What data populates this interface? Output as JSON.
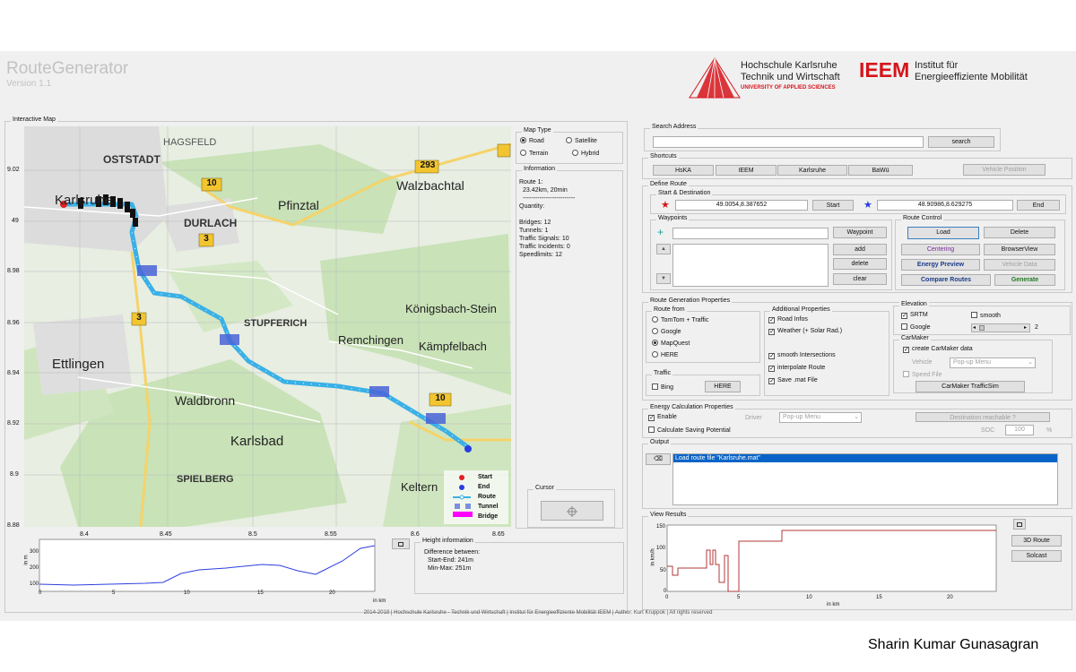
{
  "app": {
    "title": "RouteGenerator",
    "version": "Version 1.1"
  },
  "logos": {
    "hs_line1": "Hochschule Karlsruhe",
    "hs_line2": "Technik und Wirtschaft",
    "hs_line3": "UNIVERSITY OF APPLIED SCIENCES",
    "ieem": "IEEM",
    "ieem_line1": "Institut  für",
    "ieem_line2": "Energieeffiziente Mobilität"
  },
  "map": {
    "panel_title": "Interactive Map",
    "y_ticks": [
      "9.02",
      "49",
      "8.98",
      "8.96",
      "8.94",
      "8.92",
      "8.9",
      "8.88"
    ],
    "x_ticks": [
      "8.4",
      "8.45",
      "8.5",
      "8.55",
      "8.6",
      "8.65"
    ],
    "places": [
      "HAGSFELD",
      "OSTSTADT",
      "Karlsruhe",
      "DURLACH",
      "Pfinztal",
      "Walzbachtal",
      "STUPFERICH",
      "Königsbach-Stein",
      "Remchingen",
      "Kämpfelbach",
      "Ettlingen",
      "Waldbronn",
      "Karlsbad",
      "SPIELBERG",
      "Keltern"
    ],
    "road_signs": [
      "293",
      "10",
      "3",
      "3",
      "10"
    ],
    "legend": [
      "Start",
      "End",
      "Route",
      "Tunnel",
      "Bridge"
    ]
  },
  "map_type": {
    "title": "Map Type",
    "options": [
      "Road",
      "Satellite",
      "Terrain",
      "Hybrid"
    ],
    "selected": "Road"
  },
  "information": {
    "title": "Information",
    "lines": [
      "Route 1:",
      "23.42km, 20min",
      "-------------------------",
      "Quantity:",
      "",
      "Bridges: 12",
      "Tunnels: 1",
      "Traffic Signals: 10",
      "Traffic Incidents: 0",
      "Speedlimits: 12"
    ]
  },
  "cursor": {
    "title": "Cursor"
  },
  "height_info": {
    "title": "Height information",
    "lines": [
      "Difference between:",
      "Start-End: 241m",
      "Min-Max: 251m"
    ]
  },
  "height_chart": {
    "y_ticks": [
      "300",
      "200",
      "100"
    ],
    "x_ticks": [
      "0",
      "5",
      "10",
      "15",
      "20"
    ],
    "ylabel": "in m",
    "xlabel": "in km"
  },
  "search": {
    "title": "Search Address",
    "button": "search"
  },
  "shortcuts": {
    "title": "Shortcuts",
    "buttons": [
      "HsKA",
      "IEEM",
      "Karlsruhe",
      "BaWü"
    ],
    "disabled_button": "Vehicle Position"
  },
  "define_route": {
    "title": "Define Route",
    "start_dest_title": "Start & Destination",
    "start_value": "49.0054,8.387652",
    "start_button": "Start",
    "end_value": "48.90986,8.629275",
    "end_button": "End",
    "waypoints_title": "Waypoints",
    "waypoint_button": "Waypoint",
    "add_button": "add",
    "delete_button": "delete",
    "clear_button": "clear"
  },
  "route_control": {
    "title": "Route Control",
    "load": "Load",
    "delete": "Delete",
    "centering": "Centering",
    "browserview": "BrowserView",
    "energy_preview": "Energy Preview",
    "vehicle_data": "Vehicle Data",
    "compare_routes": "Compare Routes",
    "generate": "Generate"
  },
  "route_gen": {
    "title": "Route Generation Properties",
    "route_from_title": "Route from",
    "route_from": [
      "TomTom + Traffic",
      "Google",
      "MapQuest",
      "HERE"
    ],
    "route_from_selected": "MapQuest",
    "traffic_title": "Traffic",
    "bing": "Bing",
    "here_button": "HERE",
    "additional_title": "Additional Properties",
    "additional": [
      {
        "label": "Road Infos",
        "checked": true
      },
      {
        "label": "Weather (+ Solar Rad.)",
        "checked": true
      },
      {
        "label": "smooth Intersections",
        "checked": true
      },
      {
        "label": "interpolate Route",
        "checked": true
      },
      {
        "label": "Save .mat File",
        "checked": true
      }
    ]
  },
  "elevation": {
    "title": "Elevation",
    "srtm": "SRTM",
    "google": "Google",
    "smooth": "smooth",
    "slider_value": "2"
  },
  "carmaker": {
    "title": "CarMaker",
    "create": "create CarMaker data",
    "vehicle_label": "Vehicle",
    "vehicle_select": "Pop-up Menu",
    "speed_file": "Speed File",
    "trafficsim": "CarMaker TrafficSim"
  },
  "energy": {
    "title": "Energy Calculation Properties",
    "enable": "Enable",
    "saving": "Calculate Saving Potential",
    "driver_label": "Driver",
    "driver_select": "Pop-up Menu",
    "destination_button": "Destination reachable ?",
    "soc_label": "SOC",
    "soc_value": "100",
    "soc_unit": "%"
  },
  "output": {
    "title": "Output",
    "log": "Load route file \"Karlsruhe.mat\""
  },
  "view_results": {
    "title": "View Results",
    "btn_3d": "3D Route",
    "btn_solcast": "Solcast",
    "y_ticks": [
      "150",
      "100",
      "50",
      "0"
    ],
    "x_ticks": [
      "0",
      "5",
      "10",
      "15",
      "20"
    ],
    "ylabel": "in km/h",
    "xlabel": "in km"
  },
  "footer": "2014-2018   |   Hochschule Karlsruhe - Technik und Wirtschaft | Institut für Energieeffiziente Mobilität IEEM   |   Author: Kurt Kruppok   |   All rights reserved",
  "author_credit": "Sharin Kumar Gunasagran",
  "colors": {
    "route": "#3ab0e6",
    "start": "#e02020",
    "end": "#2a3de0",
    "bridge": "#ff00ff",
    "ieem_red": "#d6141b"
  }
}
